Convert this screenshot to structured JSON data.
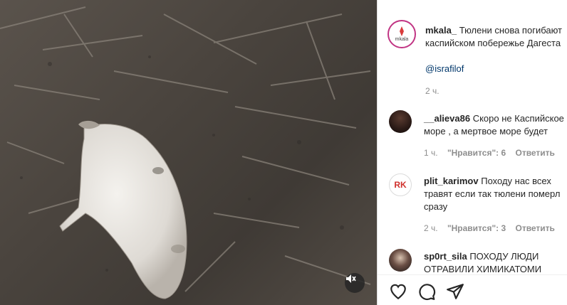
{
  "post": {
    "author": "mkala_",
    "caption_line1": "Тюлени снова погибают",
    "caption_line2": "каспийском побережье Дагеста",
    "mention": "@israfilof",
    "time": "2 ч.",
    "avatar_label": "mkala"
  },
  "comments": [
    {
      "user": "__alieva86",
      "line1": "Скоро не Каспийское",
      "line2": "море , а мертвое море будет",
      "line3": "",
      "time": "1 ч.",
      "likes": "\"Нравится\": 6",
      "reply": "Ответить"
    },
    {
      "user": "plit_karimov",
      "line1": "Походу нас всех",
      "line2": "травят если так тюлени померл",
      "line3": "сразу",
      "time": "2 ч.",
      "likes": "\"Нравится\": 3",
      "reply": "Ответить",
      "avatar_label": "RK"
    },
    {
      "user": "sp0rt_sila",
      "line1": "ПОХОДУ ЛЮДИ",
      "line2": "ОТРАВИЛИ ХИМИКАТОМИ",
      "line3": ""
    }
  ],
  "icons": [
    "volume-off-icon",
    "heart-icon",
    "comment-icon",
    "share-icon"
  ],
  "colors": {
    "accent": "#00376b",
    "secondary": "#8e8e8e",
    "avatar_ring": "#c13584"
  }
}
